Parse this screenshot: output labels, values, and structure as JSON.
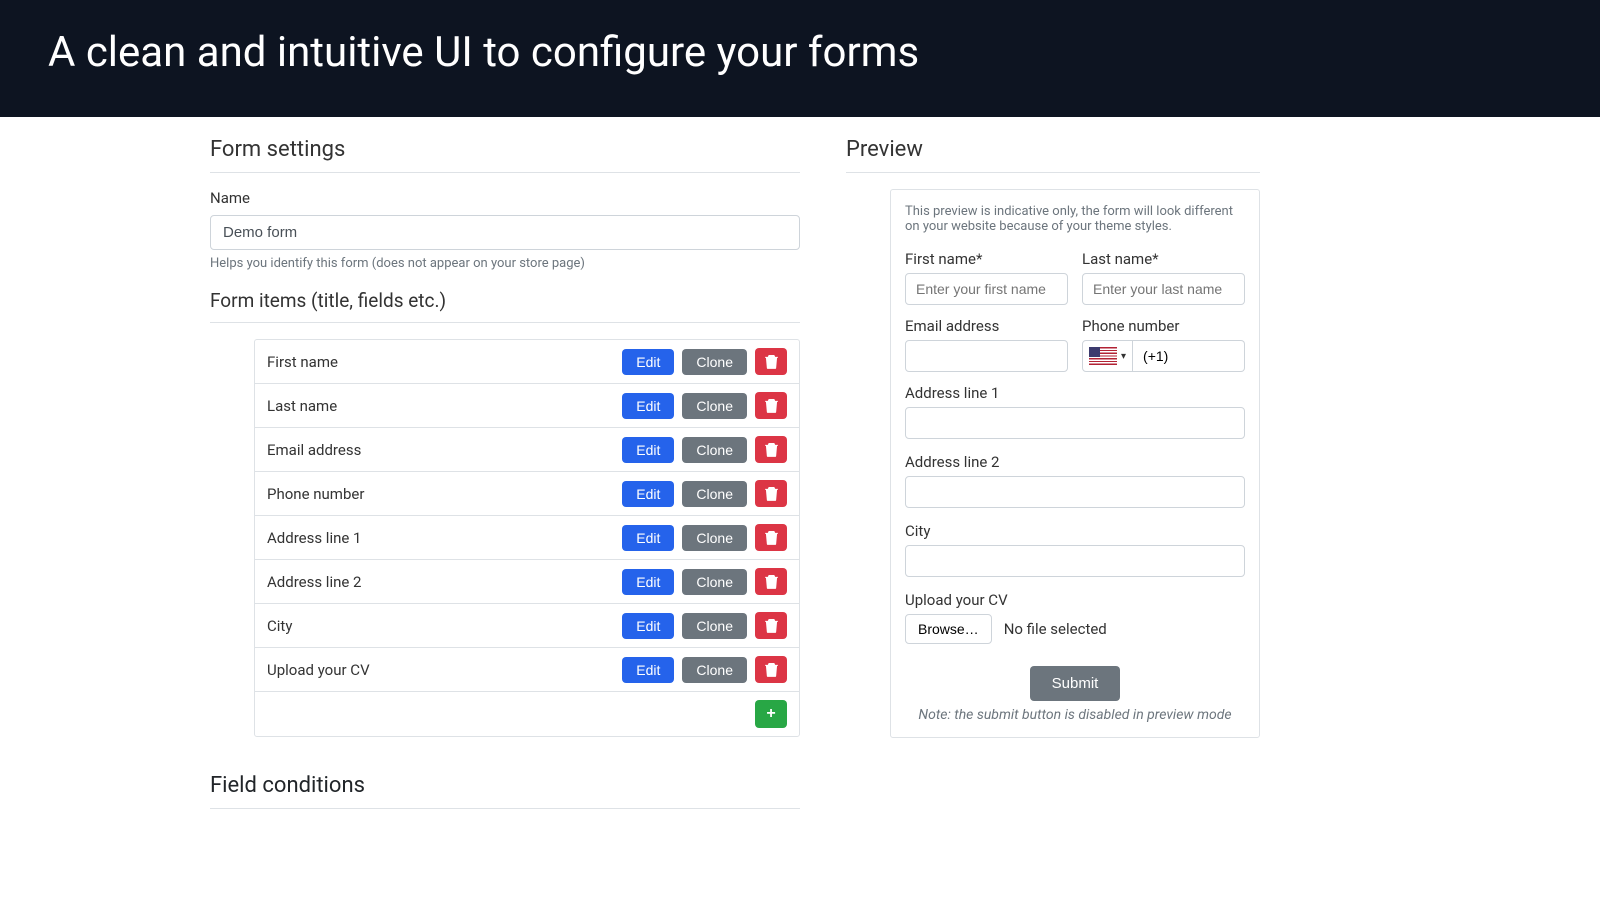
{
  "header": {
    "title": "A clean and intuitive UI to configure your forms"
  },
  "form_settings": {
    "title": "Form settings",
    "name_label": "Name",
    "name_value": "Demo form",
    "name_help": "Helps you identify this form (does not appear on your store page)",
    "items_title": "Form items (title, fields etc.)",
    "edit_label": "Edit",
    "clone_label": "Clone",
    "items": [
      {
        "label": "First name"
      },
      {
        "label": "Last name"
      },
      {
        "label": "Email address"
      },
      {
        "label": "Phone number"
      },
      {
        "label": "Address line 1"
      },
      {
        "label": "Address line 2"
      },
      {
        "label": "City"
      },
      {
        "label": "Upload your CV"
      }
    ]
  },
  "field_conditions": {
    "title": "Field conditions"
  },
  "preview": {
    "title": "Preview",
    "note": "This preview is indicative only, the form will look different on your website because of your theme styles.",
    "first_name_label": "First name*",
    "first_name_placeholder": "Enter your first name",
    "last_name_label": "Last name*",
    "last_name_placeholder": "Enter your last name",
    "email_label": "Email address",
    "phone_label": "Phone number",
    "phone_prefix": "(+1)",
    "address1_label": "Address line 1",
    "address2_label": "Address line 2",
    "city_label": "City",
    "upload_label": "Upload your CV",
    "browse_label": "Browse…",
    "no_file": "No file selected",
    "submit_label": "Submit",
    "submit_note": "Note: the submit button is disabled in preview mode"
  }
}
